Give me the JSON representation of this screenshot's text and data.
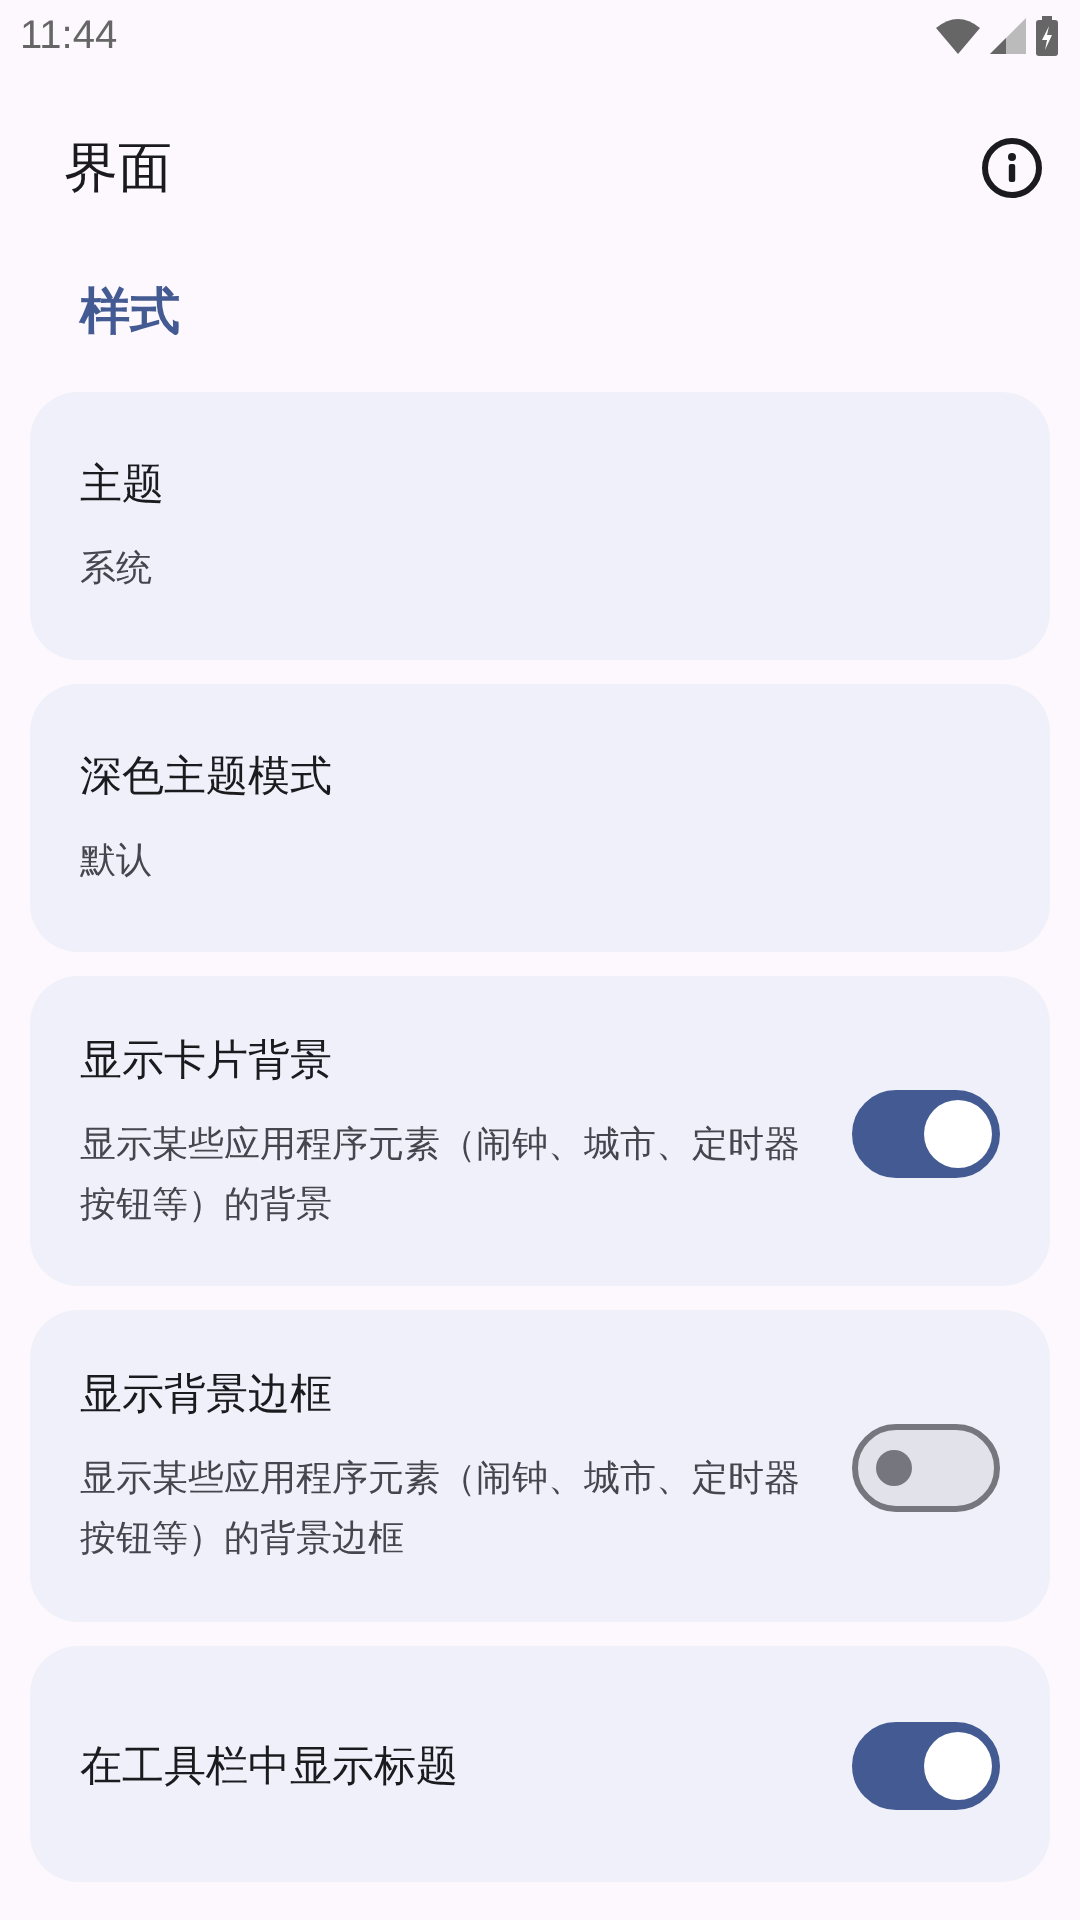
{
  "status_bar": {
    "time": "11:44"
  },
  "top_bar": {
    "title": "界面"
  },
  "section": {
    "title": "样式"
  },
  "items": [
    {
      "kind": "choice",
      "title": "主题",
      "value": "系统"
    },
    {
      "kind": "choice",
      "title": "深色主题模式",
      "value": "默认"
    },
    {
      "kind": "switch",
      "title": "显示卡片背景",
      "description": "显示某些应用程序元素（闹钟、城市、定时器按钮等）的背景",
      "on": true
    },
    {
      "kind": "switch",
      "title": "显示背景边框",
      "description": "显示某些应用程序元素（闹钟、城市、定时器按钮等）的背景边框",
      "on": false
    },
    {
      "kind": "switch",
      "title": "在工具栏中显示标题",
      "on": true
    }
  ]
}
